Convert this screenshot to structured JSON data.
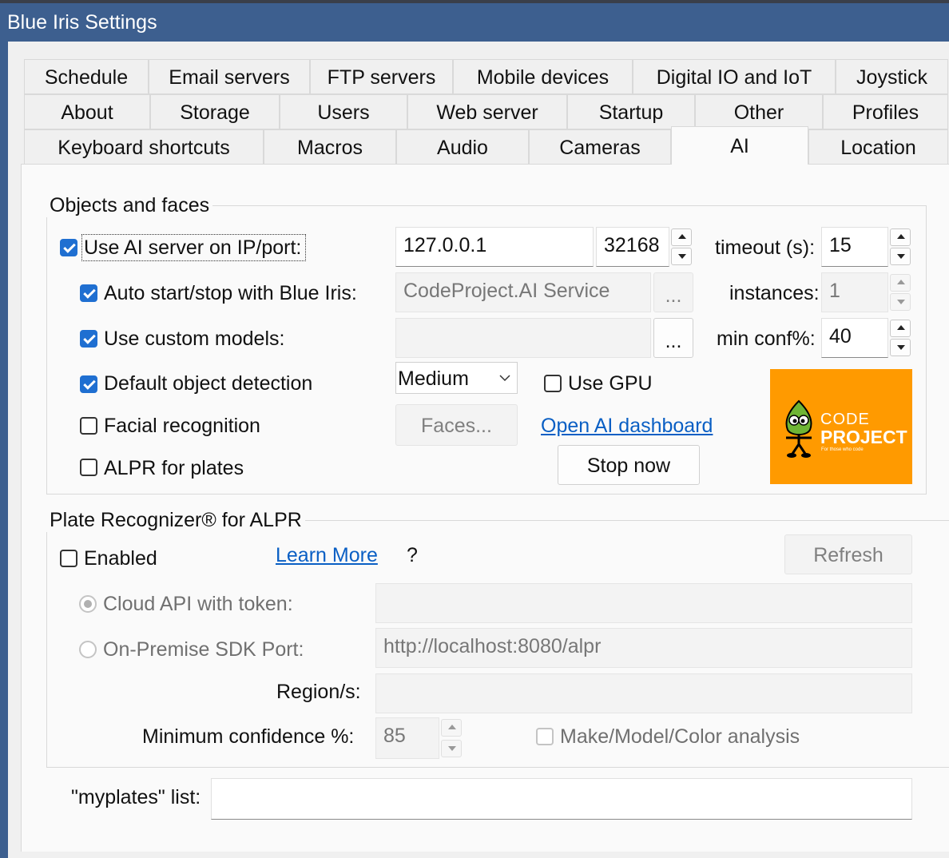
{
  "window": {
    "title": "Blue Iris Settings"
  },
  "tabs": {
    "row1": [
      "Schedule",
      "Email servers",
      "FTP servers",
      "Mobile devices",
      "Digital IO and IoT",
      "Joystick"
    ],
    "row2": [
      "About",
      "Storage",
      "Users",
      "Web server",
      "Startup",
      "Other",
      "Profiles"
    ],
    "row3": [
      "Keyboard shortcuts",
      "Macros",
      "Audio",
      "Cameras",
      "AI",
      "Location"
    ],
    "active": "AI"
  },
  "objects": {
    "group_title": "Objects and faces",
    "use_ai_label": "Use AI server on IP/port:",
    "use_ai_checked": true,
    "ip": "127.0.0.1",
    "port": "32168",
    "timeout_label": "timeout (s):",
    "timeout": "15",
    "auto_start_label": "Auto start/stop with Blue Iris:",
    "auto_start_checked": true,
    "service": "CodeProject.AI Service",
    "browse": "...",
    "instances_label": "instances:",
    "instances": "1",
    "custom_models_label": "Use custom models:",
    "custom_models_checked": true,
    "custom_models_path": "",
    "min_conf_label": "min conf%:",
    "min_conf": "40",
    "default_detection_label": "Default object detection",
    "default_detection_checked": true,
    "detection_mode": "Medium",
    "use_gpu_label": "Use GPU",
    "use_gpu_checked": false,
    "facial_label": "Facial recognition",
    "facial_checked": false,
    "faces_button": "Faces...",
    "dashboard_link": "Open AI dashboard",
    "alpr_label": "ALPR for plates",
    "alpr_checked": false,
    "stop_button": "Stop now",
    "logo": {
      "code": "CODE",
      "project": "PROJECT",
      "tagline": "For those who code"
    }
  },
  "plate": {
    "group_title": "Plate Recognizer® for ALPR",
    "enabled_label": "Enabled",
    "enabled_checked": false,
    "learn_more": "Learn More",
    "help": "?",
    "refresh": "Refresh",
    "cloud_label": "Cloud API with token:",
    "cloud_selected": true,
    "cloud_token": "",
    "onprem_label": "On-Premise SDK Port:",
    "onprem_url": "http://localhost:8080/alpr",
    "region_label": "Region/s:",
    "region": "",
    "min_conf_label": "Minimum confidence %:",
    "min_conf": "85",
    "make_model_label": "Make/Model/Color analysis",
    "make_model_checked": false
  },
  "myplates": {
    "label": "\"myplates\" list:",
    "value": ""
  },
  "colors": {
    "title_bar": "#3d5f8f",
    "accent": "#1f6fd1",
    "link": "#0a5fc4",
    "logo_bg": "#ff9a00"
  }
}
